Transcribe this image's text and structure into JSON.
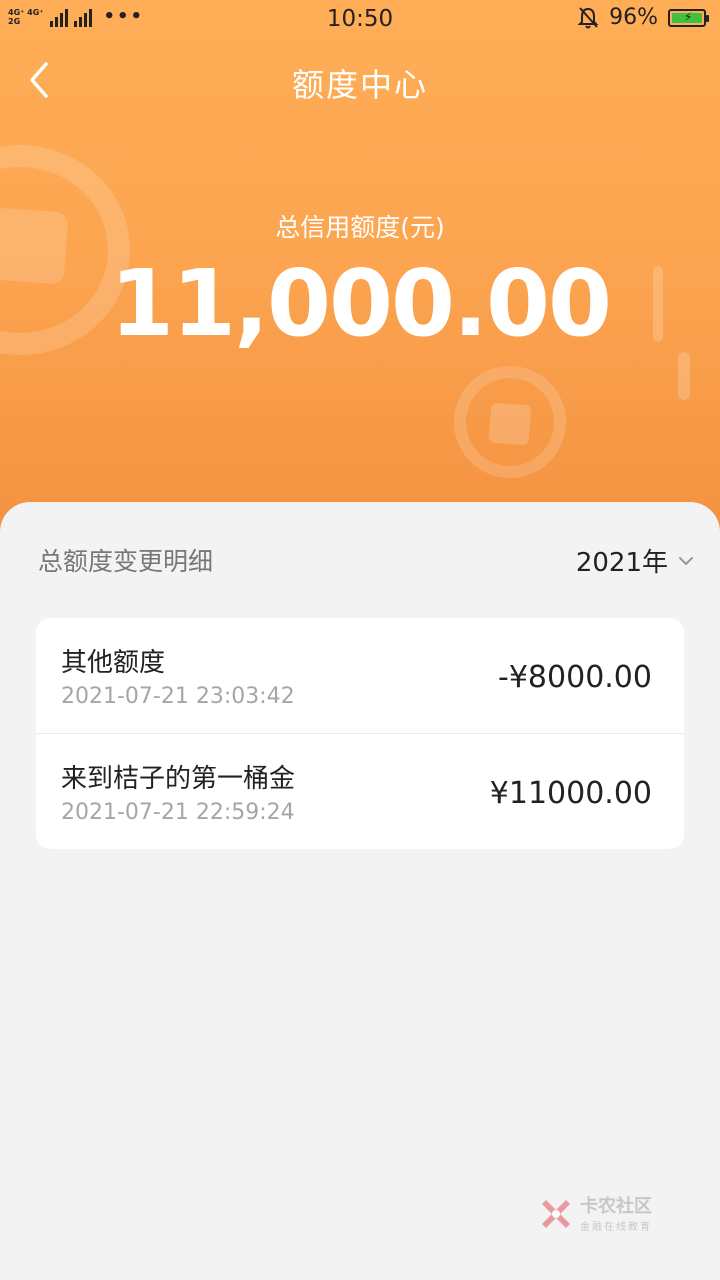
{
  "status_bar": {
    "network_top": "4G⁺ 4G⁺",
    "network_bottom": "2G",
    "dots": "•••",
    "time": "10:50",
    "battery": "96%"
  },
  "nav": {
    "title": "额度中心"
  },
  "hero": {
    "total_label": "总信用额度(元)",
    "total_value": "11,000.00"
  },
  "history": {
    "section_title": "总额度变更明细",
    "year": "2021年",
    "items": [
      {
        "title": "其他额度",
        "time": "2021-07-21 23:03:42",
        "amount": "-¥8000.00"
      },
      {
        "title": "来到桔子的第一桶金",
        "time": "2021-07-21 22:59:24",
        "amount": "¥11000.00"
      }
    ]
  },
  "watermark": {
    "main": "卡农社区",
    "sub": "金融在线教育"
  },
  "colors": {
    "accent": "#fca551",
    "text": "#222222",
    "muted": "#a6a6a6"
  }
}
